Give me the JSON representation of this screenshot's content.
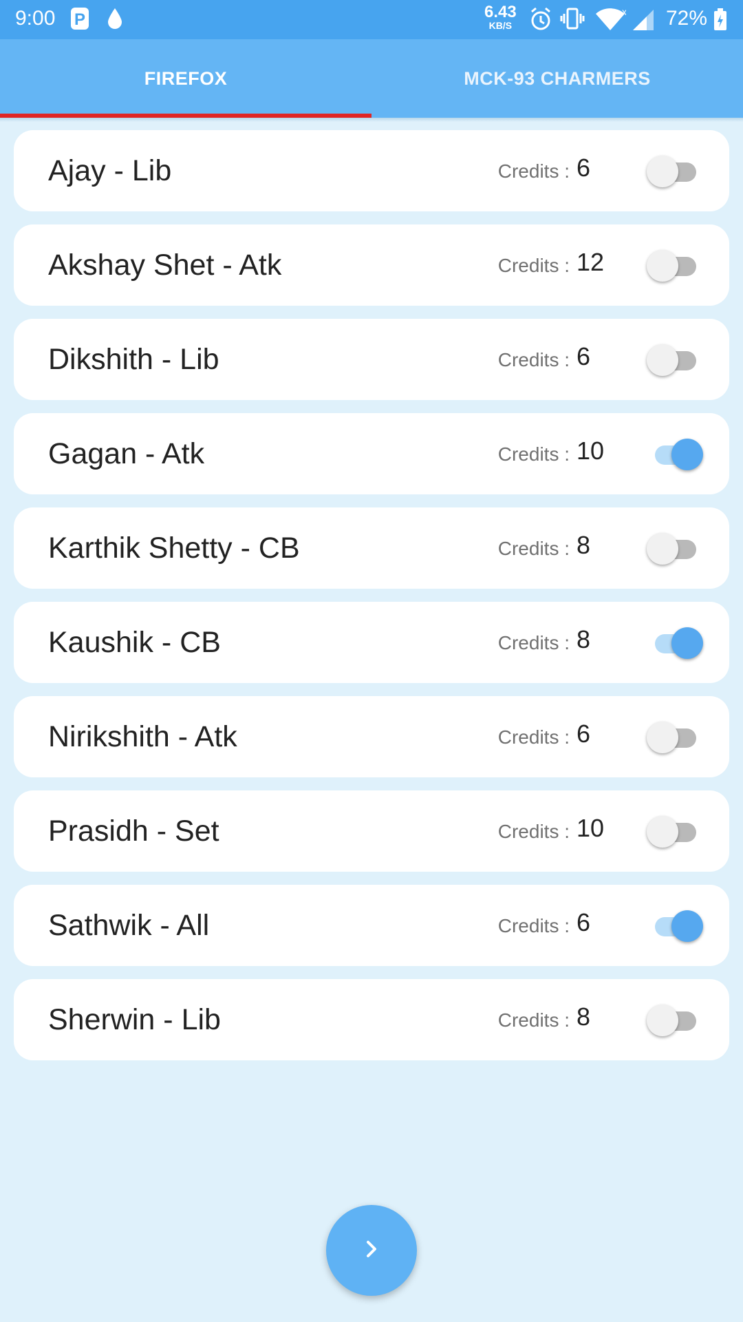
{
  "status_bar": {
    "time": "9:00",
    "net_speed_value": "6.43",
    "net_speed_unit": "KB/S",
    "battery": "72%",
    "icons": [
      "parking-icon",
      "drop-icon",
      "alarm-icon",
      "vibrate-icon",
      "wifi-icon",
      "signal-icon",
      "battery-charging-icon"
    ]
  },
  "tabs": [
    {
      "label": "FIREFOX",
      "selected": true
    },
    {
      "label": "MCK-93 CHARMERS",
      "selected": false
    }
  ],
  "credits_label": "Credits :",
  "players": [
    {
      "name": "Ajay - Lib",
      "credits": "6",
      "selected": false
    },
    {
      "name": "Akshay Shet - Atk",
      "credits": "12",
      "selected": false
    },
    {
      "name": "Dikshith - Lib",
      "credits": "6",
      "selected": false
    },
    {
      "name": "Gagan - Atk",
      "credits": "10",
      "selected": true
    },
    {
      "name": "Karthik Shetty - CB",
      "credits": "8",
      "selected": false
    },
    {
      "name": "Kaushik - CB",
      "credits": "8",
      "selected": true
    },
    {
      "name": "Nirikshith - Atk",
      "credits": "6",
      "selected": false
    },
    {
      "name": "Prasidh - Set",
      "credits": "10",
      "selected": false
    },
    {
      "name": "Sathwik - All",
      "credits": "6",
      "selected": true
    },
    {
      "name": "Sherwin - Lib",
      "credits": "8",
      "selected": false
    }
  ],
  "fab": {
    "icon": "chevron-right-icon"
  },
  "colors": {
    "primary": "#47a4ef",
    "tab_bar": "#64b5f4",
    "indicator": "#e02424",
    "background": "#dff1fb",
    "toggle_on": "#56a8ef"
  }
}
